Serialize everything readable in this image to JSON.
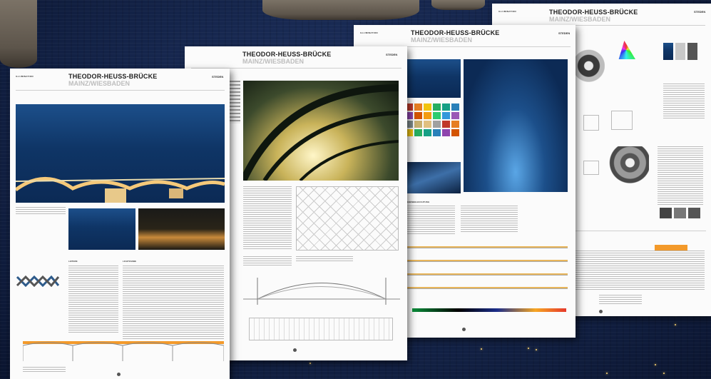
{
  "brand": "ILLUMINATION",
  "title": "THEODOR-HEUSS-BRÜCKE",
  "subtitle": "MAINZ/WIESBADEN",
  "sheets": [
    {
      "code": "STEDEN",
      "heading_left": "LEITERE",
      "heading_right": "LICHTFARBE"
    },
    {
      "code": "STEDEN"
    },
    {
      "code": "STEDEN",
      "heading_left": "SIEBENBELEUCHTUNG"
    },
    {
      "code": "STEDEN"
    }
  ],
  "colors": {
    "water": "#14244a",
    "sheet": "#fbfbfb",
    "title": "#222222",
    "subtitle": "#bdbdbd",
    "night_sky": "#1c4f8a",
    "bridge_light": "#f5c97a",
    "accent_orange": "#f39a2b"
  }
}
